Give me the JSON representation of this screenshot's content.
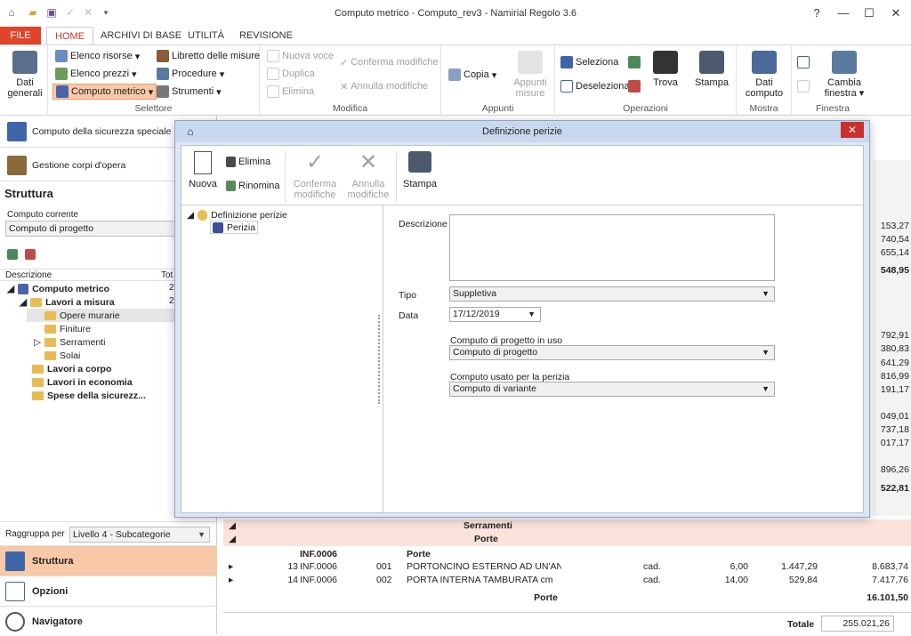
{
  "window": {
    "title": "Computo metrico - Computo_rev3 - Namirial Regolo 3.6",
    "help": "?",
    "minimize": "—",
    "maximize": "☐",
    "close": "✕"
  },
  "tabs": [
    "FILE",
    "HOME",
    "ARCHIVI DI BASE",
    "UTILITÀ",
    "REVISIONE"
  ],
  "ribbon": {
    "dati_generali": "Dati generali",
    "selettore": {
      "label": "Selettore",
      "elenco_risorse": "Elenco risorse",
      "elenco_prezzi": "Elenco prezzi",
      "computo_metrico": "Computo metrico",
      "libretto": "Libretto delle misure",
      "procedure": "Procedure",
      "strumenti": "Strumenti"
    },
    "modifica": {
      "label": "Modifica",
      "nuova_voce": "Nuova voce",
      "duplica": "Duplica",
      "elimina": "Elimina",
      "conferma": "Conferma modifiche",
      "annulla": "Annulla modifiche"
    },
    "appunti": {
      "label": "Appunti",
      "copia": "Copia",
      "appunti_misure": "Appunti misure"
    },
    "operazioni": {
      "label": "Operazioni",
      "seleziona": "Seleziona",
      "deseleziona": "Deseleziona",
      "trova": "Trova",
      "stampa": "Stampa"
    },
    "mostra": {
      "label": "Mostra",
      "dati_computo": "Dati computo"
    },
    "finestra": {
      "label": "Finestra",
      "cambia": "Cambia finestra"
    }
  },
  "left": {
    "sicurezza": "Computo della sicurezza speciale",
    "corpi": "Gestione corpi d'opera",
    "struttura_title": "Struttura",
    "computo_corrente_label": "Computo corrente",
    "computo_corrente": "Computo di progetto",
    "col_descrizione": "Descrizione",
    "col_tot": "Tot",
    "tree": [
      {
        "label": "Computo metrico",
        "val": "2"
      },
      {
        "label": "Lavori a misura",
        "val": "2"
      },
      {
        "label": "Opere murarie"
      },
      {
        "label": "Finiture"
      },
      {
        "label": "Serramenti"
      },
      {
        "label": "Solai"
      },
      {
        "label": "Lavori a corpo"
      },
      {
        "label": "Lavori in economia"
      },
      {
        "label": "Spese della sicurezz..."
      }
    ],
    "raggruppa_label": "Raggruppa per",
    "raggruppa": "Livello 4 - Subcategorie",
    "nav": [
      "Struttura",
      "Opzioni",
      "Navigatore"
    ]
  },
  "grid": {
    "right_values": [
      "153,27",
      "740,54",
      "655,14",
      "548,95",
      "792,91",
      "380,83",
      "641,29",
      "816,99",
      "191,17",
      "049,01",
      "737,18",
      "017,17",
      "896,26",
      "522,81"
    ],
    "serramenti": "Serramenti",
    "porte_header": "Porte",
    "code_header": "INF.0006",
    "rows": [
      {
        "n": "13",
        "code": "INF.0006",
        "sub": "001",
        "desc": "PORTONCINO ESTERNO AD UN'ANTA IN",
        "um": "cad.",
        "qty": "6,00",
        "price": "1.447,29",
        "tot": "8.683,74"
      },
      {
        "n": "14",
        "code": "INF.0006",
        "sub": "002",
        "desc": "PORTA INTERNA TAMBURATA cm",
        "um": "cad.",
        "qty": "14,00",
        "price": "529,84",
        "tot": "7.417,76"
      }
    ],
    "porte_total_label": "Porte",
    "porte_total": "16.101,50",
    "totale_label": "Totale",
    "totale": "255.021,26"
  },
  "dialog": {
    "title": "Definizione perizie",
    "nuova": "Nuova",
    "elimina": "Elimina",
    "rinomina": "Rinomina",
    "conferma": "Conferma modifiche",
    "annulla": "Annulla modifiche",
    "stampa": "Stampa",
    "tree_root": "Definizione perizie",
    "tree_child": "Perizia",
    "descrizione_label": "Descrizione",
    "descrizione": "",
    "tipo_label": "Tipo",
    "tipo": "Suppletiva",
    "data_label": "Data",
    "data": "17/12/2019",
    "progetto_label": "Computo di progetto in uso",
    "progetto": "Computo di progetto",
    "variante_label": "Computo usato per la perizia",
    "variante": "Computo di variante"
  },
  "colors": {
    "accent": "#e0442a",
    "selected": "#f8c9a8",
    "dialog_title": "#c9d8ec"
  }
}
